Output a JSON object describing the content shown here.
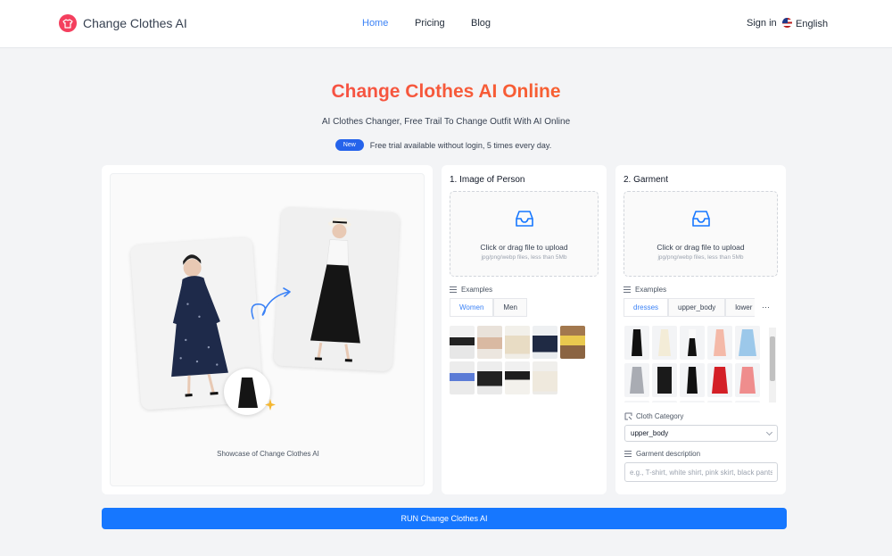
{
  "header": {
    "brand": "Change Clothes AI",
    "nav": [
      {
        "label": "Home",
        "active": true
      },
      {
        "label": "Pricing",
        "active": false
      },
      {
        "label": "Blog",
        "active": false
      }
    ],
    "sign_in": "Sign in",
    "language": "English",
    "brand_color": "#f43f5e",
    "accent_color": "#3b82f6"
  },
  "hero": {
    "title": "Change Clothes AI Online",
    "subtitle": "AI Clothes Changer, Free Trail To Change Outfit With AI Online",
    "badge": "New",
    "note": "Free trial available without login, 5 times every day."
  },
  "showcase": {
    "caption": "Showcase of Change Clothes AI"
  },
  "person_panel": {
    "title": "1. Image of Person",
    "upload_text": "Click or drag file to upload",
    "upload_hint": "jpg/png/webp files, less than 5Mb",
    "examples_label": "Examples",
    "tabs": [
      {
        "label": "Women",
        "active": true
      },
      {
        "label": "Men",
        "active": false
      }
    ]
  },
  "garment_panel": {
    "title": "2. Garment",
    "upload_text": "Click or drag file to upload",
    "upload_hint": "jpg/png/webp files, less than 5Mb",
    "examples_label": "Examples",
    "tabs": [
      {
        "label": "dresses",
        "active": true
      },
      {
        "label": "upper_body",
        "active": false
      },
      {
        "label": "lower",
        "active": false
      }
    ],
    "more": "···",
    "category_label": "Cloth Category",
    "category_value": "upper_body",
    "description_label": "Garment description",
    "description_placeholder": "e.g., T-shirt, white shirt, pink skirt, black pants"
  },
  "run_button": "RUN Change Clothes AI"
}
